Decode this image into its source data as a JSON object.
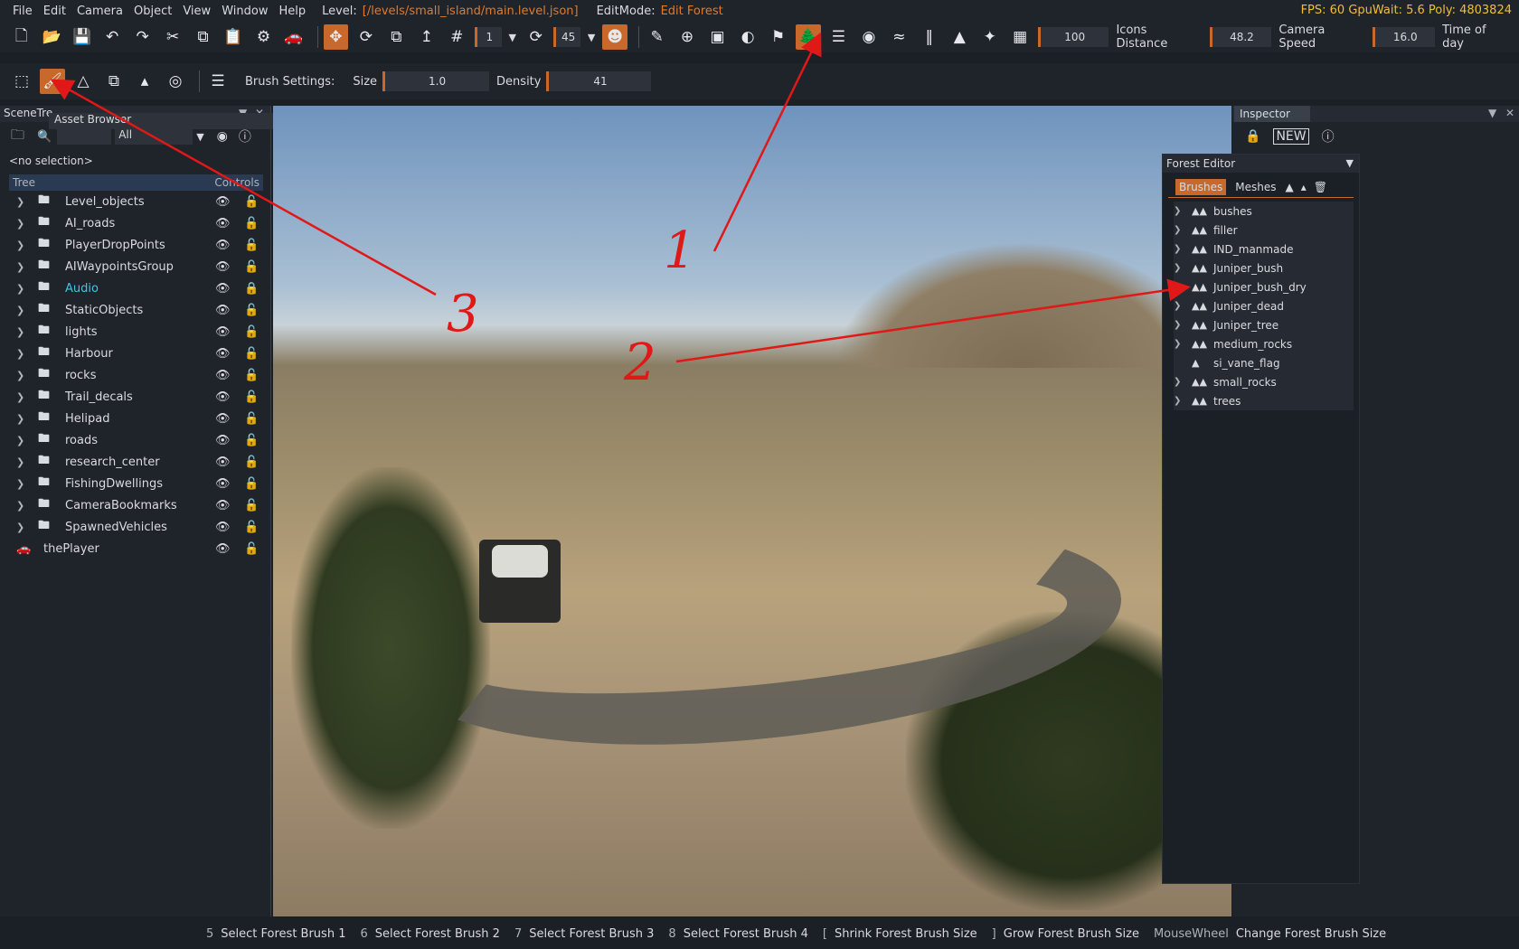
{
  "menu": {
    "items": [
      "File",
      "Edit",
      "Camera",
      "Object",
      "View",
      "Window",
      "Help"
    ],
    "level_label": "Level:",
    "level_path": "[/levels/small_island/main.level.json]",
    "editmode_label": "EditMode:",
    "editmode_value": "Edit Forest",
    "stats": "FPS: 60  GpuWait: 5.6  Poly: 4803824"
  },
  "toolbar1": {
    "snap_value": "1",
    "rotate_value": "45",
    "value_100": "100",
    "icons_distance_label": "Icons Distance",
    "icons_distance": "48.2",
    "camera_speed_label": "Camera Speed",
    "camera_speed": "16.0",
    "time_of_day_label": "Time of day"
  },
  "toolbar2": {
    "brush_settings_label": "Brush Settings:",
    "size_label": "Size",
    "size_value": "1.0",
    "density_label": "Density",
    "density_value": "41"
  },
  "scenetree": {
    "tab": "SceneTre",
    "asset_browser": "Asset Browser",
    "filter": "All",
    "no_selection": "<no selection>",
    "col_tree": "Tree",
    "col_controls": "Controls",
    "items": [
      {
        "name": "Level_objects"
      },
      {
        "name": "AI_roads"
      },
      {
        "name": "PlayerDropPoints"
      },
      {
        "name": "AIWaypointsGroup"
      },
      {
        "name": "Audio"
      },
      {
        "name": "StaticObjects"
      },
      {
        "name": "lights"
      },
      {
        "name": "Harbour"
      },
      {
        "name": "rocks"
      },
      {
        "name": "Trail_decals"
      },
      {
        "name": "Helipad"
      },
      {
        "name": "roads"
      },
      {
        "name": "research_center"
      },
      {
        "name": "FishingDwellings"
      },
      {
        "name": "CameraBookmarks"
      },
      {
        "name": "SpawnedVehicles"
      },
      {
        "name": "thePlayer"
      }
    ]
  },
  "inspector": {
    "tab": "Inspector",
    "new_badge": "NEW"
  },
  "forest_editor": {
    "title": "Forest Editor",
    "tabs": [
      "Brushes",
      "Meshes"
    ],
    "brushes": [
      {
        "name": "bushes"
      },
      {
        "name": "filler"
      },
      {
        "name": "IND_manmade"
      },
      {
        "name": "Juniper_bush"
      },
      {
        "name": "Juniper_bush_dry"
      },
      {
        "name": "Juniper_dead"
      },
      {
        "name": "Juniper_tree"
      },
      {
        "name": "medium_rocks"
      },
      {
        "name": "si_vane_flag"
      },
      {
        "name": "small_rocks"
      },
      {
        "name": "trees"
      }
    ]
  },
  "statusbar": {
    "hints": [
      {
        "key": "5",
        "action": "Select Forest Brush 1"
      },
      {
        "key": "6",
        "action": "Select Forest Brush 2"
      },
      {
        "key": "7",
        "action": "Select Forest Brush 3"
      },
      {
        "key": "8",
        "action": "Select Forest Brush 4"
      },
      {
        "key": "[",
        "action": "Shrink Forest Brush Size"
      },
      {
        "key": "]",
        "action": "Grow Forest Brush Size"
      },
      {
        "key": "MouseWheel",
        "action": "Change Forest Brush Size"
      }
    ]
  },
  "annotations": {
    "one": "1",
    "two": "2",
    "three": "3"
  },
  "colors": {
    "accent": "#c8682a",
    "stats": "#f0c030",
    "annotation": "#e01818",
    "audio_highlight": "#3fc6e6"
  }
}
